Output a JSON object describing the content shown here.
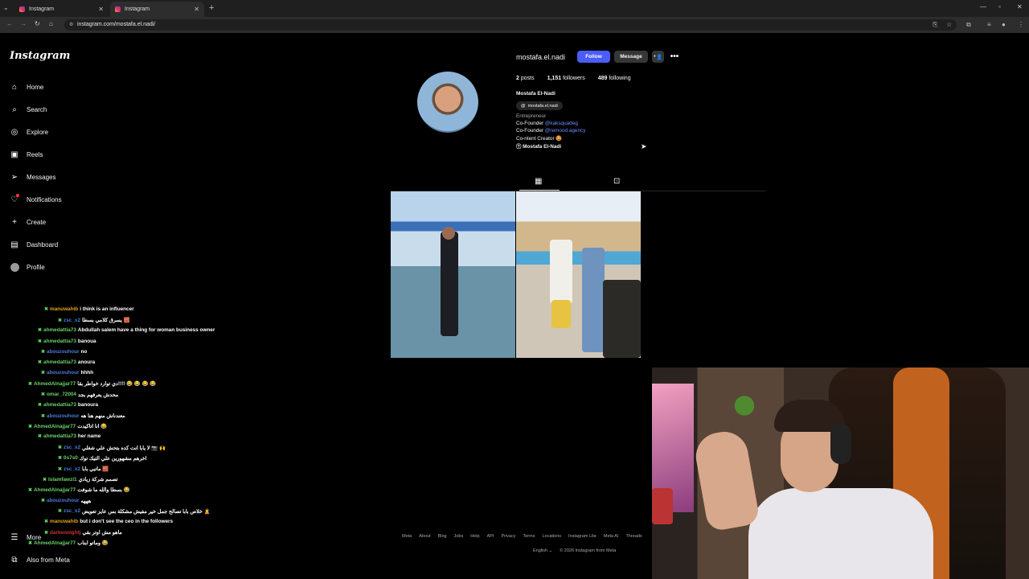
{
  "browser": {
    "tabs": [
      {
        "label": "Instagram",
        "active": false
      },
      {
        "label": "Instagram",
        "active": true
      }
    ],
    "url": "instagram.com/mostafa.el.nadi/"
  },
  "sidebar": {
    "logo": "Instagram",
    "items": [
      {
        "label": "Home",
        "icon": "home-icon"
      },
      {
        "label": "Search",
        "icon": "search-icon"
      },
      {
        "label": "Explore",
        "icon": "compass-icon"
      },
      {
        "label": "Reels",
        "icon": "reels-icon"
      },
      {
        "label": "Messages",
        "icon": "send-icon"
      },
      {
        "label": "Notifications",
        "icon": "heart-icon"
      },
      {
        "label": "Create",
        "icon": "plus-icon"
      },
      {
        "label": "Dashboard",
        "icon": "dashboard-icon"
      },
      {
        "label": "Profile",
        "icon": "avatar-icon"
      }
    ],
    "more": "More",
    "also_from_meta": "Also from Meta"
  },
  "profile": {
    "username": "mostafa.el.nadi",
    "follow_label": "Follow",
    "message_label": "Message",
    "stats": {
      "posts_count": "2",
      "posts_label": "posts",
      "followers_count": "1,151",
      "followers_label": "followers",
      "following_count": "489",
      "following_label": "following"
    },
    "full_name": "Mostafa El-Nadi",
    "threads_handle": "mostafa.el.nadi",
    "category": "Entrepreneur",
    "bio": {
      "line1_prefix": "Co-Founder ",
      "line1_link": "@kaksquadeg",
      "line2_prefix": "Co-Founder ",
      "line2_link": "@remood.agency",
      "line3": "Co-ntent Creator 🤩",
      "line4": "Ⓣ Mostafa El-Nadi"
    }
  },
  "footer": {
    "links": [
      "Meta",
      "About",
      "Blog",
      "Jobs",
      "Help",
      "API",
      "Privacy",
      "Terms",
      "Locations",
      "Instagram Lite",
      "Meta AI",
      "Threads"
    ],
    "language": "English",
    "copyright": "© 2026 Instagram from Meta"
  },
  "chat": [
    {
      "user": "manuwahib",
      "color": "#e3a21a",
      "text": "i think is an influencer"
    },
    {
      "user": "zsc_x2",
      "color": "#4a7bdc",
      "text": "يسرق كلامي بسطا 🧱"
    },
    {
      "user": "ahmedattia73",
      "color": "#6ad16a",
      "text": "Abdullah salem have a thing for woman business owner"
    },
    {
      "user": "ahmedattia73",
      "color": "#6ad16a",
      "text": "banoua"
    },
    {
      "user": "abouzouhour",
      "color": "#4a7bdc",
      "text": "no"
    },
    {
      "user": "ahmedattia73",
      "color": "#6ad16a",
      "text": "anoura"
    },
    {
      "user": "abouzouhour",
      "color": "#4a7bdc",
      "text": "hhhh"
    },
    {
      "user": "AhmedAlnajjar77",
      "color": "#6ad16a",
      "text": "دي توارد خواطر بقا!!!! 😂 😂 😂 😂"
    },
    {
      "user": "omar_72004",
      "color": "#6ad16a",
      "text": "محدش يعرفهم بجد"
    },
    {
      "user": "ahmedattia73",
      "color": "#6ad16a",
      "text": "banoura"
    },
    {
      "user": "abouzouhour",
      "color": "#4a7bdc",
      "text": "معندناش منهم هنا هه"
    },
    {
      "user": "AhmedAlnajjar77",
      "color": "#6ad16a",
      "text": "انا اتاكيدت 😂"
    },
    {
      "user": "ahmedattia73",
      "color": "#6ad16a",
      "text": "her name"
    },
    {
      "user": "zsc_x2",
      "color": "#4a7bdc",
      "text": "لا يابا انت كده بتحش علي شغلي 📷 🙌"
    },
    {
      "user": "0s7s0",
      "color": "#6ad16a",
      "text": "اخرهم مشهورين علي التيك توك"
    },
    {
      "user": "zsc_x2",
      "color": "#4a7bdc",
      "text": "ماتبي بابا 🧱"
    },
    {
      "user": "Islamfawzi1",
      "color": "#6ad16a",
      "text": "تصمم شركة زيادي"
    },
    {
      "user": "AhmedAlnajjar77",
      "color": "#6ad16a",
      "text": "بسطا والله ما شوفت 😂"
    },
    {
      "user": "abouzouhour",
      "color": "#4a7bdc",
      "text": "هههه"
    },
    {
      "user": "zsc_x2",
      "color": "#4a7bdc",
      "text": "خلاص بابا تصالح جمل خير مفيش مشكلة بس عايز تعويض 🙎"
    },
    {
      "user": "manuwahib",
      "color": "#e3a21a",
      "text": "but i don't see the ceo in the followers"
    },
    {
      "user": "darkenoightj",
      "color": "#d0302a",
      "text": "ماهو مش اوتر بقي"
    },
    {
      "user": "AhmedAlnajjar77",
      "color": "#6ad16a",
      "text": "وماتو ابناب 😂"
    }
  ]
}
